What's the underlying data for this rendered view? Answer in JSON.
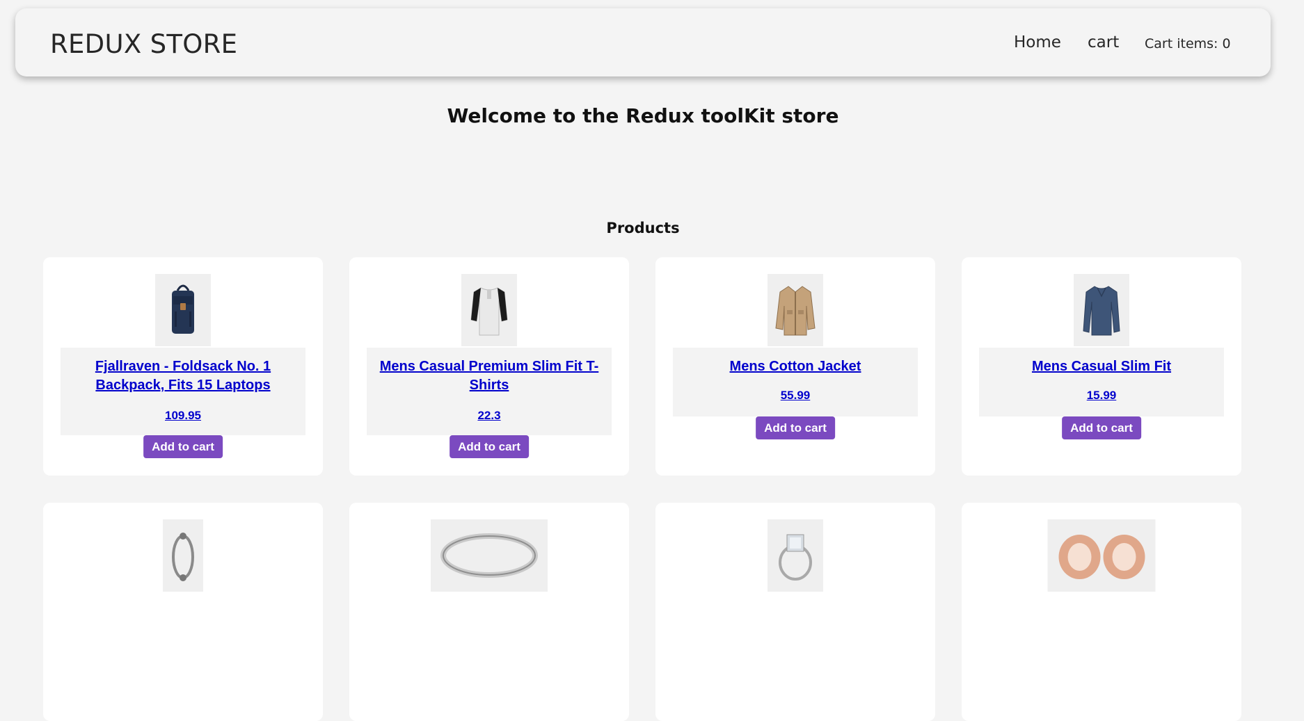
{
  "header": {
    "brand": "REDUX STORE",
    "nav": {
      "home": "Home",
      "cart": "cart",
      "cart_items": "Cart items: 0"
    }
  },
  "welcome": "Welcome to the Redux toolKit store",
  "products_heading": "Products",
  "products": [
    {
      "title": "Fjallraven - Foldsack No. 1 Backpack, Fits 15 Laptops",
      "price": "109.95",
      "button": "Add to cart",
      "icon": "backpack-image"
    },
    {
      "title": "Mens Casual Premium Slim Fit T-Shirts",
      "price": "22.3",
      "button": "Add to cart",
      "icon": "tshirt-image"
    },
    {
      "title": "Mens Cotton Jacket",
      "price": "55.99",
      "button": "Add to cart",
      "icon": "jacket-image"
    },
    {
      "title": "Mens Casual Slim Fit",
      "price": "15.99",
      "button": "Add to cart",
      "icon": "longsleeve-image"
    },
    {
      "icon": "bracelet-image"
    },
    {
      "icon": "ring-band-image"
    },
    {
      "icon": "diamond-ring-image"
    },
    {
      "icon": "ear-plugs-image"
    }
  ],
  "colors": {
    "button": "#7b4ac0",
    "link": "#0000cc",
    "background": "#f4f4f4"
  }
}
